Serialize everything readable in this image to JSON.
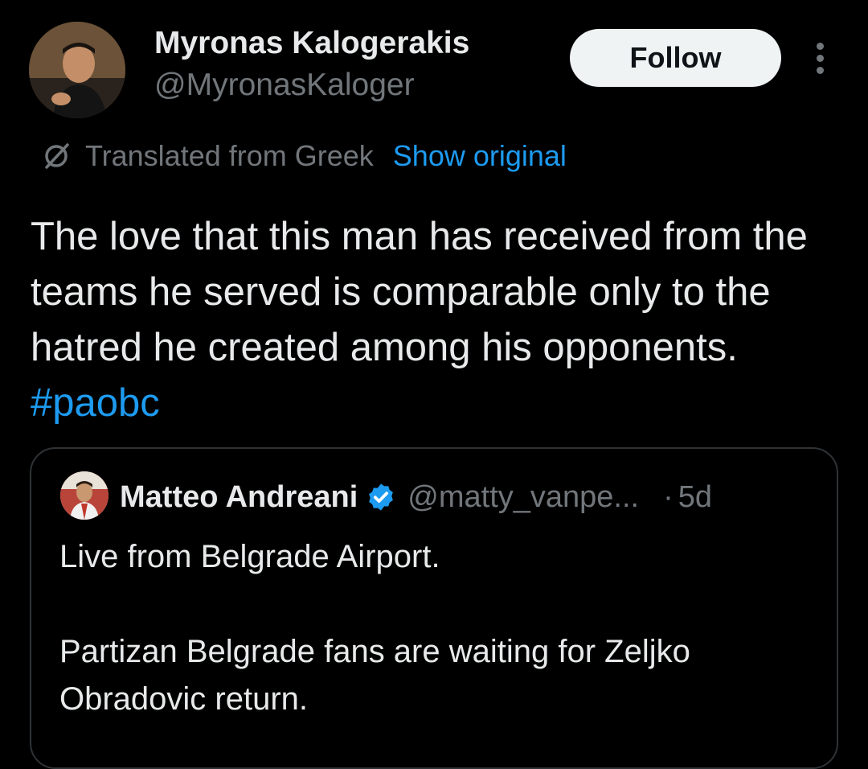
{
  "author": {
    "name": "Myronas Kalogerakis",
    "handle": "@MyronasKaloger",
    "avatar_alt": "profile-photo"
  },
  "actions": {
    "follow_label": "Follow",
    "more_icon": "more-vertical-icon"
  },
  "translation": {
    "icon": "translate-icon",
    "label": "Translated from Greek",
    "show_original_label": "Show original"
  },
  "tweet": {
    "text": "The love that this man has received from the teams he served is comparable only to the hatred he created among his opponents.",
    "hashtag": "#paobc"
  },
  "quote": {
    "name": "Matteo Andreani",
    "verified_icon": "verified-badge-icon",
    "handle": "@matty_vanpe...",
    "separator": "·",
    "time": "5d",
    "text": "Live from Belgrade Airport.\n\nPartizan Belgrade fans are waiting for Zeljko Obradovic return."
  },
  "colors": {
    "background": "#000000",
    "text_primary": "#e7e9ea",
    "text_secondary": "#71767b",
    "accent": "#1d9bf0",
    "follow_bg": "#eff3f4",
    "border": "#2f3336"
  }
}
